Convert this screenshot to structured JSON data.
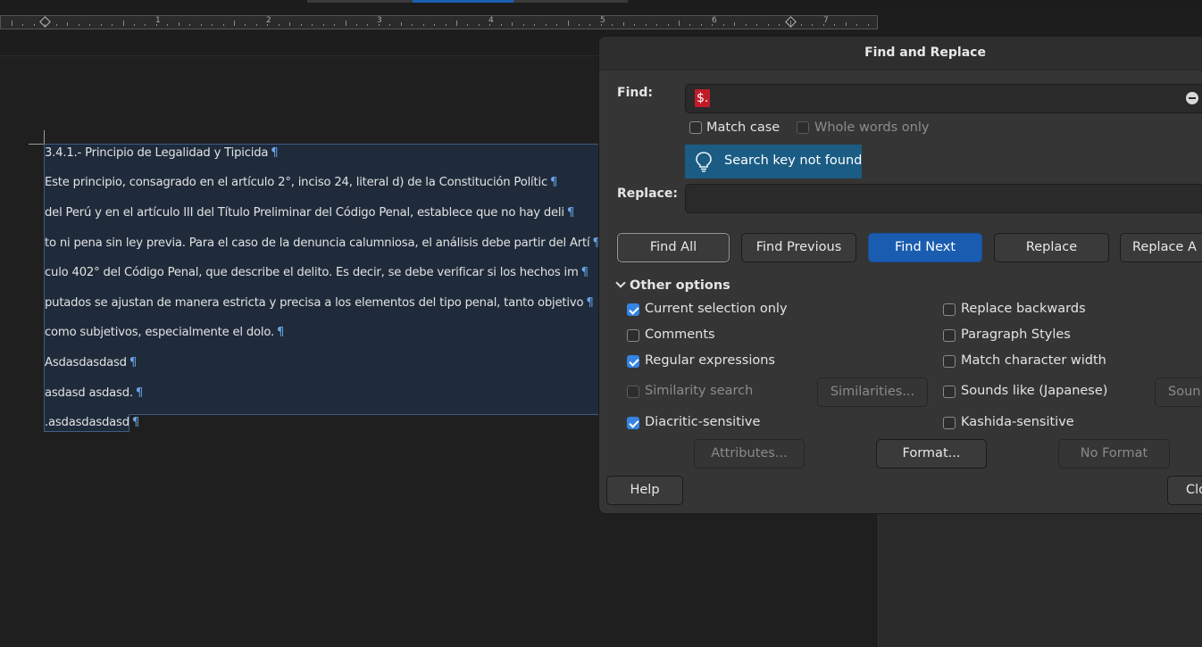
{
  "document": {
    "paragraphs": [
      {
        "text": "3.4.1.- Principio de Legalidad y Tipicida",
        "mark": "¶"
      },
      {
        "text": "Este principio, consagrado en el artículo 2°, inciso 24, literal d) de la Constitución Polític",
        "mark": "¶"
      },
      {
        "text": "del Perú y en el artículo III del Título Preliminar del Código Penal, establece que no hay deli",
        "mark": "¶"
      },
      {
        "text": "to ni pena sin ley previa. Para el caso de la denuncia calumniosa, el análisis debe partir del Artí",
        "mark": "¶"
      },
      {
        "text": "culo 402° del Código Penal, que describe el delito. Es decir, se debe verificar si los hechos im",
        "mark": "¶"
      },
      {
        "text": "putados se ajustan de manera estricta y precisa a los elementos del tipo penal, tanto objetivo",
        "mark": "¶"
      },
      {
        "text": "como subjetivos, especialmente el dolo.",
        "mark": "¶"
      },
      {
        "text": "Asdasdasdasd",
        "mark": "¶"
      },
      {
        "text": "asdasd  asdasd.",
        "mark": "¶"
      },
      {
        "text": ".asdasdasdasd",
        "mark": "¶"
      }
    ]
  },
  "ruler": {
    "numbers": [
      "1",
      "2",
      "3",
      "4",
      "5",
      "6",
      "7"
    ]
  },
  "dialog": {
    "title": "Find and Replace",
    "find_label": "Find:",
    "find_value": "$.",
    "replace_label": "Replace:",
    "replace_value": "",
    "match_case": {
      "label": "Match case",
      "checked": false
    },
    "whole_words": {
      "label": "Whole words only",
      "checked": false
    },
    "info_message": "Search key not found",
    "buttons": {
      "find_all": "Find All",
      "find_previous": "Find Previous",
      "find_next": "Find Next",
      "replace": "Replace",
      "replace_all": "Replace A"
    },
    "other_options_label": "Other options",
    "options_left": [
      {
        "label": "Current selection only",
        "checked": true
      },
      {
        "label": "Comments",
        "checked": false
      },
      {
        "label": "Regular expressions",
        "checked": true
      },
      {
        "label": "Similarity search",
        "checked": false
      },
      {
        "label": "Diacritic-sensitive",
        "checked": true
      }
    ],
    "options_right": [
      {
        "label": "Replace backwards",
        "checked": false
      },
      {
        "label": "Paragraph Styles",
        "checked": false
      },
      {
        "label": "Match character width",
        "checked": false
      },
      {
        "label": "Sounds like (Japanese)",
        "checked": false
      },
      {
        "label": "Kashida-sensitive",
        "checked": false
      }
    ],
    "similarities_button": "Similarities...",
    "sounds_button": "Soun",
    "attributes_button": "Attributes...",
    "format_button": "Format...",
    "no_format_button": "No Format",
    "help_button": "Help",
    "close_button": "Clo"
  },
  "colors": {
    "accent": "#1a5cb0",
    "info_bar": "#1a5c83",
    "search_highlight": "#c01c28",
    "selection": "#1f2b3b"
  }
}
